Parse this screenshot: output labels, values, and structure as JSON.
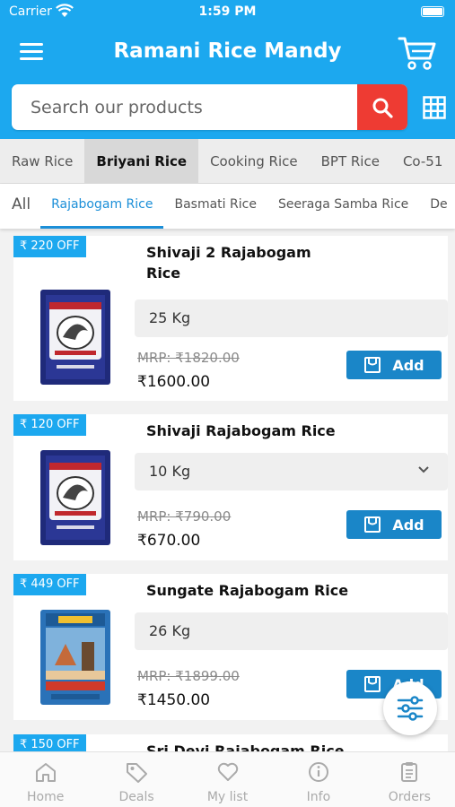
{
  "status_bar": {
    "carrier": "Carrier",
    "time": "1:59 PM"
  },
  "header": {
    "title": "Ramani Rice Mandy"
  },
  "search": {
    "placeholder": "Search our products"
  },
  "category_tabs": [
    {
      "label": "Raw Rice",
      "active": false
    },
    {
      "label": "Briyani Rice",
      "active": true
    },
    {
      "label": "Cooking Rice",
      "active": false
    },
    {
      "label": "BPT Rice",
      "active": false
    },
    {
      "label": "Co-51",
      "active": false
    }
  ],
  "sub_tabs": [
    {
      "label": "All",
      "active": false
    },
    {
      "label": "Rajabogam Rice",
      "active": true
    },
    {
      "label": "Basmati Rice",
      "active": false
    },
    {
      "label": "Seeraga Samba Rice",
      "active": false
    },
    {
      "label": "De",
      "active": false
    }
  ],
  "products": [
    {
      "discount": "₹ 220 OFF",
      "name": "Shivaji 2 Rajabogam Rice",
      "quantity": "25 Kg",
      "mrp": "MRP: ₹1820.00",
      "price": "₹1600.00",
      "add_label": "Add"
    },
    {
      "discount": "₹ 120 OFF",
      "name": "Shivaji Rajabogam Rice",
      "quantity": "10 Kg",
      "mrp": "MRP: ₹790.00",
      "price": "₹670.00",
      "add_label": "Add"
    },
    {
      "discount": "₹ 449 OFF",
      "name": "Sungate Rajabogam Rice",
      "quantity": "26 Kg",
      "mrp": "MRP: ₹1899.00",
      "price": "₹1450.00",
      "add_label": "Add"
    },
    {
      "discount": "₹ 150 OFF",
      "name": "Sri Devi Rajabogam Rice"
    }
  ],
  "bottom_nav": [
    {
      "label": "Home",
      "icon": "home-icon"
    },
    {
      "label": "Deals",
      "icon": "tag-icon"
    },
    {
      "label": "My list",
      "icon": "heart-icon"
    },
    {
      "label": "Info",
      "icon": "info-icon"
    },
    {
      "label": "Orders",
      "icon": "clipboard-icon"
    }
  ],
  "colors": {
    "primary": "#1ca8ef",
    "search_button": "#ee3b33",
    "add_button": "#1a86c8",
    "active_subtab": "#1c8fd8"
  }
}
